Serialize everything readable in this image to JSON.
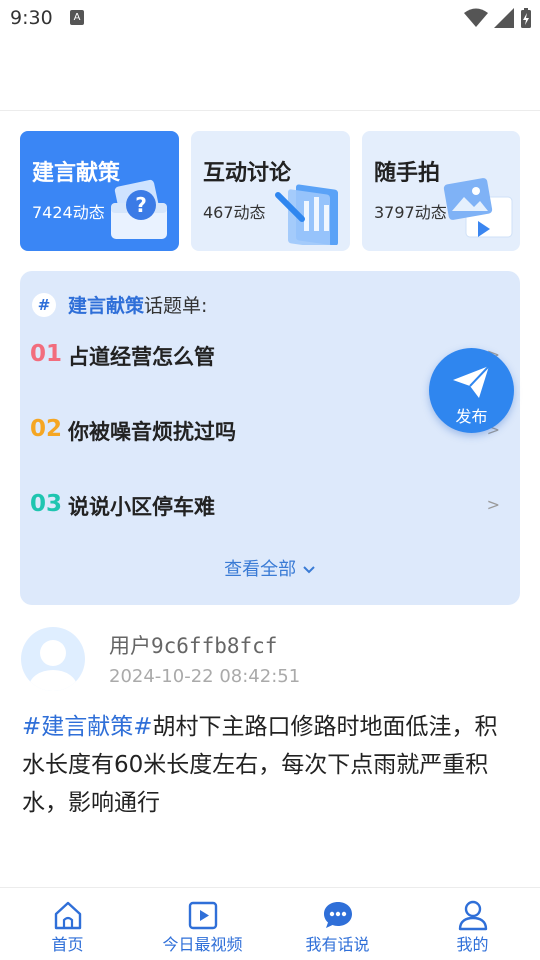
{
  "status_bar": {
    "time": "9:30",
    "icons": [
      "a-notification-icon",
      "wifi-icon",
      "signal-icon",
      "battery-charging-icon"
    ]
  },
  "categories": [
    {
      "title": "建言献策",
      "count": "7424动态",
      "active": true
    },
    {
      "title": "互动讨论",
      "count": "467动态",
      "active": false
    },
    {
      "title": "随手拍",
      "count": "3797动态",
      "active": false
    }
  ],
  "topics": {
    "hash": "#",
    "header_highlight": "建言献策",
    "header_suffix": "话题单:",
    "items": [
      {
        "num": "01",
        "text": "占道经营怎么管",
        "arrow": ">",
        "color": "#f26d7d"
      },
      {
        "num": "02",
        "text": "你被噪音烦扰过吗",
        "arrow": ">",
        "color": "#f5a623"
      },
      {
        "num": "03",
        "text": "说说小区停车难",
        "arrow": ">",
        "color": "#1fc5b0"
      }
    ],
    "view_all": "查看全部"
  },
  "fab": {
    "label": "发布"
  },
  "post": {
    "username": "用户9c6ffb8fcf",
    "time": "2024-10-22 08:42:51",
    "tag": "#建言献策#",
    "content": "胡村下主路口修路时地面低洼，积水长度有60米长度左右，每次下点雨就严重积水，影响通行"
  },
  "bottom_nav": [
    {
      "label": "首页",
      "icon": "home-icon"
    },
    {
      "label": "今日最视频",
      "icon": "video-play-icon"
    },
    {
      "label": "我有话说",
      "icon": "chat-bubble-icon"
    },
    {
      "label": "我的",
      "icon": "user-icon"
    }
  ],
  "colors": {
    "accent": "#3a86f5",
    "topic_bg": "#dde9fb",
    "link": "#2f6fd8"
  }
}
